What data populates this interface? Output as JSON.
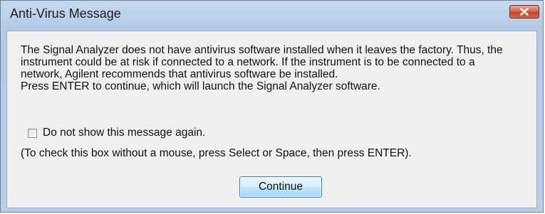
{
  "window": {
    "title": "Anti-Virus Message"
  },
  "message": {
    "paragraph": "The Signal Analyzer does not have antivirus software installed when it leaves the factory.  Thus, the instrument could be at risk if connected to a network.  If the instrument is to be connected to a network, Agilent recommends that antivirus software be installed.",
    "instruction": "Press ENTER to continue, which will launch the Signal Analyzer software."
  },
  "checkbox": {
    "label": "Do not show this message again.",
    "checked": false
  },
  "hint": "(To check this box without a mouse, press Select or Space, then press ENTER).",
  "buttons": {
    "continue_label": "Continue"
  },
  "icons": {
    "close": "close-icon"
  },
  "colors": {
    "close_button": "#c2462b",
    "titlebar": "#c6d9ef",
    "client_background": "#f0f0f0",
    "default_button_border": "#3c7fb1"
  }
}
